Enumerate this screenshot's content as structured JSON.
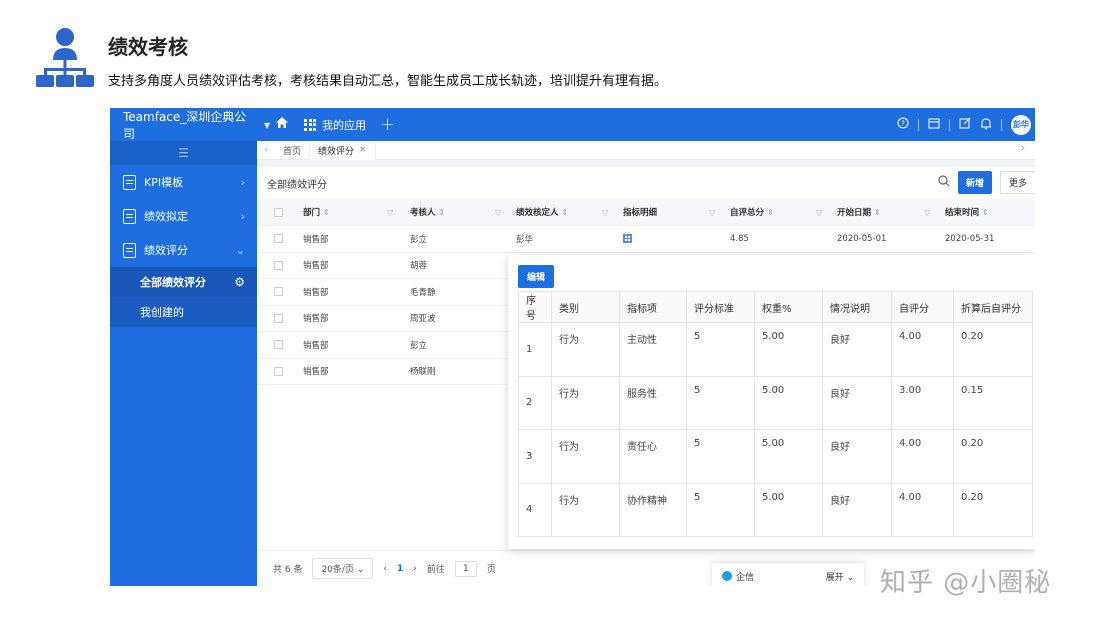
{
  "hero": {
    "title": "绩效考核",
    "description": "支持多角度人员绩效评估考核，考核结果自动汇总，智能生成员工成长轨迹，培训提升有理有据。"
  },
  "topbar": {
    "company": "Teamface_深圳企典公司",
    "apps_label": "我的应用",
    "avatar_text": "彭华"
  },
  "sidebar": {
    "items": [
      {
        "label": "KPI模板"
      },
      {
        "label": "绩效拟定"
      },
      {
        "label": "绩效评分"
      }
    ],
    "subitems": [
      {
        "label": "全部绩效评分"
      },
      {
        "label": "我创建的"
      }
    ]
  },
  "tabs": [
    {
      "label": "首页"
    },
    {
      "label": "绩效评分"
    }
  ],
  "list": {
    "title": "全部绩效评分",
    "new_button": "新增",
    "more_button": "更多",
    "columns": [
      "部门",
      "考核人",
      "绩效核定人",
      "指标明细",
      "自评总分",
      "开始日期",
      "结束时间"
    ],
    "rows": [
      {
        "dept": "销售部",
        "assessor": "彭立",
        "approver": "彭华",
        "score": "4.85",
        "start": "2020-05-01",
        "end": "2020-05-31"
      },
      {
        "dept": "销售部",
        "assessor": "胡蓉"
      },
      {
        "dept": "销售部",
        "assessor": "毛青静"
      },
      {
        "dept": "销售部",
        "assessor": "周亚波"
      },
      {
        "dept": "销售部",
        "assessor": "彭立"
      },
      {
        "dept": "销售部",
        "assessor": "杨联刚"
      }
    ]
  },
  "pager": {
    "total": "共 6 条",
    "page_size": "20条/页",
    "current": "1",
    "goto_label": "前往",
    "goto_value": "1",
    "page_suffix": "页"
  },
  "detail": {
    "edit_button": "编辑",
    "columns": [
      "序号",
      "类别",
      "指标项",
      "评分标准",
      "权重%",
      "情况说明",
      "自评分",
      "折算后自评分"
    ],
    "rows": [
      {
        "idx": "1",
        "category": "行为",
        "item": "主动性",
        "standard": "5",
        "weight": "5.00",
        "note": "良好",
        "self": "4.00",
        "converted": "0.20"
      },
      {
        "idx": "2",
        "category": "行为",
        "item": "服务性",
        "standard": "5",
        "weight": "5.00",
        "note": "良好",
        "self": "3.00",
        "converted": "0.15"
      },
      {
        "idx": "3",
        "category": "行为",
        "item": "责任心",
        "standard": "5",
        "weight": "5.00",
        "note": "良好",
        "self": "4.00",
        "converted": "0.20"
      },
      {
        "idx": "4",
        "category": "行为",
        "item": "协作精神",
        "standard": "5",
        "weight": "5.00",
        "note": "良好",
        "self": "4.00",
        "converted": "0.20"
      }
    ]
  },
  "chat": {
    "label": "企信",
    "expand": "展开"
  },
  "watermark": "知乎 @小圈秘"
}
